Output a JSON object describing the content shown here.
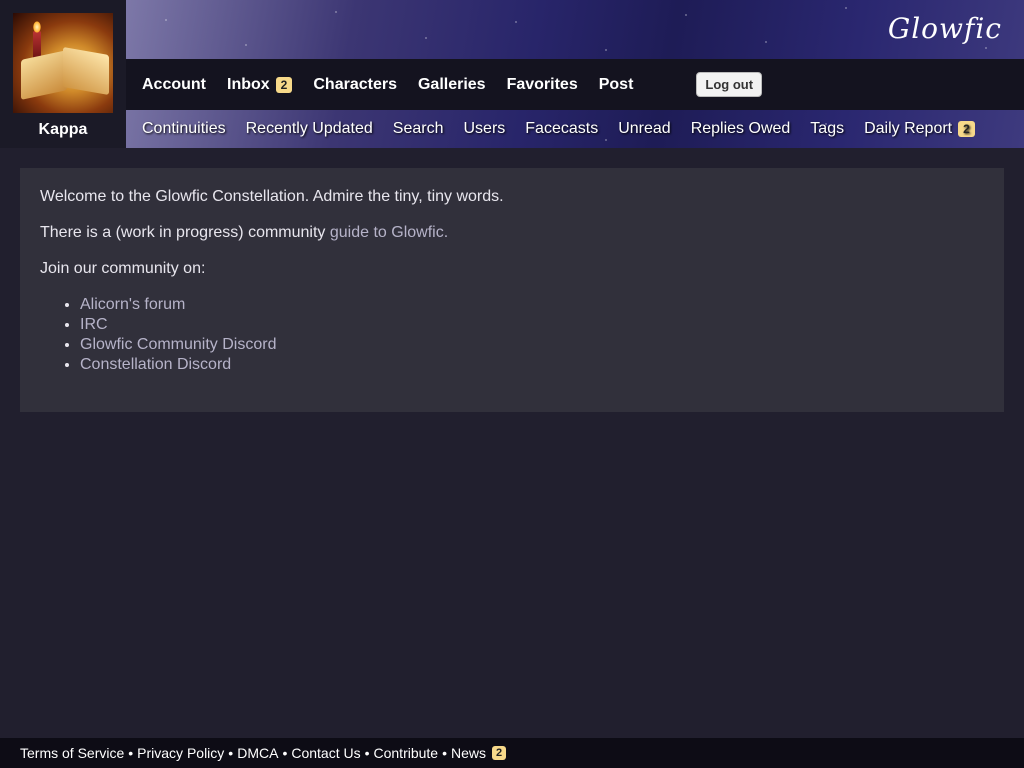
{
  "site": {
    "logo": "Glowfic"
  },
  "user": {
    "name": "Kappa"
  },
  "primary_nav": {
    "account": "Account",
    "inbox": "Inbox",
    "inbox_badge": "2",
    "characters": "Characters",
    "galleries": "Galleries",
    "favorites": "Favorites",
    "post": "Post",
    "logout": "Log out"
  },
  "secondary_nav": {
    "continuities": "Continuities",
    "recently_updated": "Recently Updated",
    "search": "Search",
    "users": "Users",
    "facecasts": "Facecasts",
    "unread": "Unread",
    "replies_owed": "Replies Owed",
    "tags": "Tags",
    "daily_report": "Daily Report",
    "daily_report_badge": "2"
  },
  "content": {
    "welcome": "Welcome to the Glowfic Constellation. Admire the tiny, tiny words.",
    "guide_prefix": "There is a (work in progress) community ",
    "guide_link": "guide to Glowfic.",
    "join_text": "Join our community on:",
    "community_links": [
      "Alicorn's forum",
      "IRC",
      "Glowfic Community Discord",
      "Constellation Discord"
    ]
  },
  "footer": {
    "terms": "Terms of Service",
    "privacy": "Privacy Policy",
    "dmca": "DMCA",
    "contact": "Contact Us",
    "contribute": "Contribute",
    "news": "News",
    "news_badge": "2",
    "separator": "•"
  },
  "colors": {
    "background": "#211f2e",
    "content_panel": "#31303b",
    "nav_bar": "#14131f",
    "badge": "#f7d98a",
    "link": "#b6b3c9"
  }
}
